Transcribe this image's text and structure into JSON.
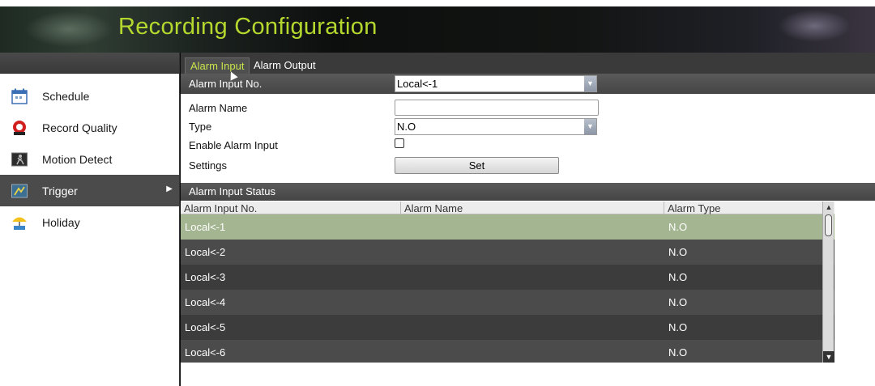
{
  "header": {
    "title": "Recording Configuration"
  },
  "sidebar": {
    "items": [
      {
        "label": "Schedule",
        "icon": "calendar-icon"
      },
      {
        "label": "Record Quality",
        "icon": "record-icon"
      },
      {
        "label": "Motion Detect",
        "icon": "motion-icon"
      },
      {
        "label": "Trigger",
        "icon": "trigger-icon",
        "active": true
      },
      {
        "label": "Holiday",
        "icon": "umbrella-icon"
      }
    ]
  },
  "tabs": [
    {
      "label": "Alarm Input",
      "active": true
    },
    {
      "label": "Alarm Output",
      "active": false
    }
  ],
  "alarm_input": {
    "no_label": "Alarm Input No.",
    "no_value": "Local<-1",
    "name_label": "Alarm Name",
    "name_value": "",
    "type_label": "Type",
    "type_value": "N.O",
    "enable_label": "Enable Alarm Input",
    "enable_checked": false,
    "settings_label": "Settings",
    "set_button": "Set"
  },
  "status": {
    "title": "Alarm Input Status",
    "columns": [
      "Alarm Input No.",
      "Alarm Name",
      "Alarm Type"
    ],
    "rows": [
      {
        "no": "Local<-1",
        "name": "",
        "type": "N.O",
        "selected": true
      },
      {
        "no": "Local<-2",
        "name": "",
        "type": "N.O"
      },
      {
        "no": "Local<-3",
        "name": "",
        "type": "N.O"
      },
      {
        "no": "Local<-4",
        "name": "",
        "type": "N.O"
      },
      {
        "no": "Local<-5",
        "name": "",
        "type": "N.O"
      },
      {
        "no": "Local<-6",
        "name": "",
        "type": "N.O"
      }
    ]
  },
  "colors": {
    "title_green": "#b5d82f",
    "tab_active_text": "#c7e44a",
    "row_selected": "#a4b591",
    "row_dark": "#3c3c3c",
    "row_mid": "#4b4b4b"
  }
}
